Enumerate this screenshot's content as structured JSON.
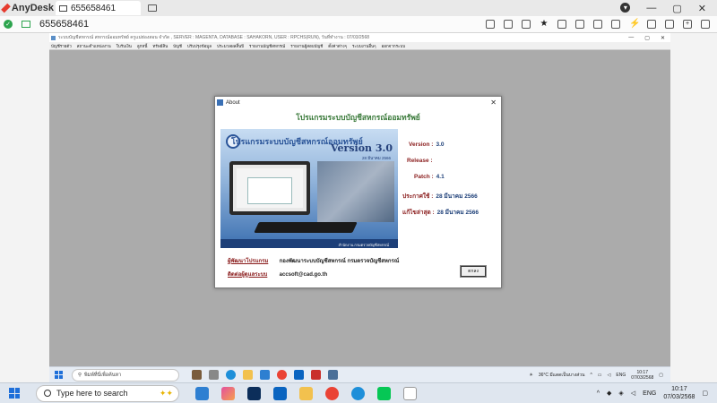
{
  "anydesk": {
    "app_name": "AnyDesk",
    "tab_label": "655658461",
    "address": "655658461"
  },
  "remote_window": {
    "title": "ระบบบัญชีสหกรณ์ สหกรณ์ออมทรัพย์ ครูแม่ฮ่องสอน จำกัด , SERVER : MAGENTA, DATABASE : SAHAKORN, USER : RPCHS(RUN), วันที่ทำงาน : 07/03/2568",
    "menu": [
      "บัญชีรายตัว",
      "สถานะตำแหน่งงาน",
      "ใบรับเงิน",
      "ลูกหนี้",
      "ทรัพย์สิน",
      "บัญชี",
      "ปรับปรุงข้อมูล",
      "ประมวลผลสิ้นปี",
      "รายงานบัญชีสหกรณ์",
      "รายงานผู้สอบบัญชี",
      "ตั้งค่าต่างๆ",
      "ระบบงานอื่นๆ",
      "ออกจากระบบ"
    ]
  },
  "about": {
    "window_title": "About",
    "heading": "โปรแกรมระบบบัญชีสหกรณ์ออมทรัพย์",
    "splash": {
      "title": "โปรแกรมระบบบัญชีสหกรณ์ออมทรัพย์",
      "version": "Version 3.0",
      "date": "28 มีนาคม 2566",
      "footer": "สำนักงาน กรมตรวจบัญชีสหกรณ์"
    },
    "info": {
      "version_label": "Version :",
      "version_value": "3.0",
      "release_label": "Release :",
      "release_value": "",
      "patch_label": "Patch :",
      "patch_value": "4.1",
      "install_label": "ประกาศใช้ :",
      "install_value": "28 มีนาคม 2566",
      "updated_label": "แก้ไขล่าสุด :",
      "updated_value": "28 มีนาคม 2566"
    },
    "developer_link": "ผู้พัฒนาโปรแกรม",
    "developer_text": "กองพัฒนาระบบบัญชีสหกรณ์ กรมตรวจบัญชีสหกรณ์",
    "contact_link": "ติดต่อผู้ดูแลระบบ",
    "contact_text": "accsoft@cad.go.th",
    "ok_label": "ตกลง"
  },
  "remote_taskbar": {
    "search_placeholder": "พิมพ์ที่นี่เพื่อค้นหา",
    "weather": "36°C มีแดดเป็นบางส่วน",
    "lang": "ENG",
    "time": "10:17",
    "date": "07/03/2568"
  },
  "host_taskbar": {
    "search_placeholder": "Type here to search",
    "lang": "ENG",
    "time": "10:17",
    "date": "07/03/2568"
  }
}
